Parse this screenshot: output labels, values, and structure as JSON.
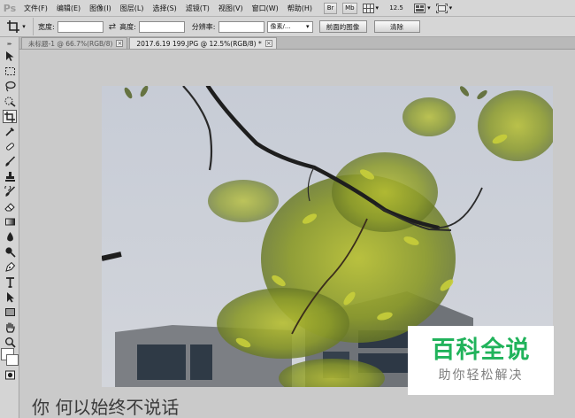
{
  "app": {
    "logo": "Ps"
  },
  "menu": {
    "items": [
      "文件(F)",
      "编辑(E)",
      "图像(I)",
      "图层(L)",
      "选择(S)",
      "滤镜(T)",
      "视图(V)",
      "窗口(W)",
      "帮助(H)"
    ],
    "bridge_label": "Br",
    "minibridge_label": "Mb",
    "zoom": "12.5"
  },
  "options": {
    "width_label": "宽度:",
    "height_label": "高度:",
    "resolution_label": "分辨率:",
    "unit_select": "像素/...",
    "front_image_button": "前面的图像",
    "clear_button": "清除"
  },
  "tabs": [
    {
      "label": "未标题-1 @ 66.7%(RGB/8)"
    },
    {
      "label": "2017.6.19 199.JPG @ 12.5%(RGB/8) *"
    }
  ],
  "watermark": {
    "title": "百科全说",
    "subtitle": "助你轻松解决"
  },
  "caption": "你 何以始终不说话",
  "colors": {
    "chrome": "#d6d6d6",
    "workspace": "#cacaca",
    "watermark_green": "#21b35b",
    "sky": "#c9ced8",
    "leaf": "#9aa828"
  },
  "icons": {
    "crop": "crop-icon",
    "move": "move-icon",
    "marquee": "marquee-icon",
    "lasso": "lasso-icon",
    "quick_select": "quick-select-icon",
    "eyedropper": "eyedropper-icon",
    "healing": "healing-brush-icon",
    "brush": "brush-icon",
    "stamp": "clone-stamp-icon",
    "history_brush": "history-brush-icon",
    "eraser": "eraser-icon",
    "gradient": "gradient-icon",
    "blur": "blur-icon",
    "dodge": "dodge-icon",
    "pen": "pen-icon",
    "type": "type-icon",
    "path_select": "path-selection-icon",
    "shape": "rectangle-shape-icon",
    "hand": "hand-icon",
    "zoom": "zoom-icon",
    "quick_mask": "quick-mask-icon"
  }
}
